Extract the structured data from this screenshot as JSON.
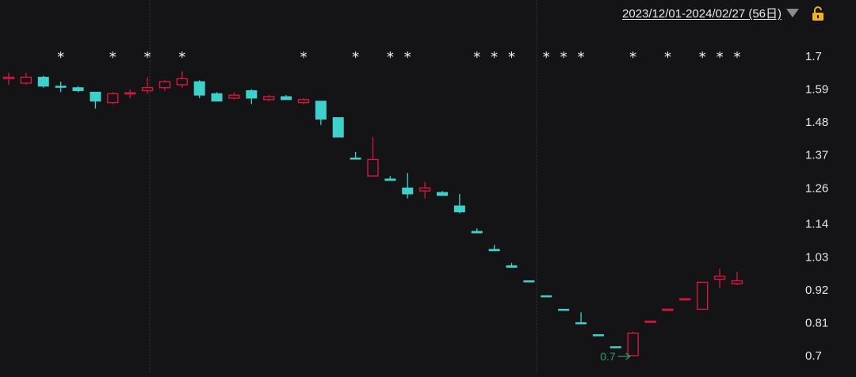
{
  "header": {
    "range_label": "2023/12/01-2024/02/27 (56日)",
    "caret_icon": "triangle-down-icon",
    "lock_icon": "unlocked-padlock-icon"
  },
  "colors": {
    "background": "#141416",
    "up": "#d6173f",
    "down": "#3ed1cc",
    "grid": "#3a3a3e",
    "min_marker": "#2f9e6a"
  },
  "chart_data": {
    "type": "candlestick",
    "title": "",
    "xlabel": "",
    "ylabel": "",
    "ylim": [
      0.67,
      1.73
    ],
    "y_ticks": [
      "1.7",
      "1.59",
      "1.48",
      "1.37",
      "1.26",
      "1.14",
      "1.03",
      "0.92",
      "0.81",
      "0.7"
    ],
    "grid": "vertical dashed separators",
    "candles": [
      {
        "o": 1.625,
        "h": 1.645,
        "l": 1.605,
        "c": 1.63,
        "dir": "up"
      },
      {
        "o": 1.61,
        "h": 1.645,
        "l": 1.605,
        "c": 1.63,
        "dir": "up"
      },
      {
        "o": 1.63,
        "h": 1.635,
        "l": 1.595,
        "c": 1.6,
        "dir": "down"
      },
      {
        "o": 1.6,
        "h": 1.615,
        "l": 1.58,
        "c": 1.6,
        "dir": "down"
      },
      {
        "o": 1.595,
        "h": 1.6,
        "l": 1.58,
        "c": 1.585,
        "dir": "down"
      },
      {
        "o": 1.58,
        "h": 1.58,
        "l": 1.525,
        "c": 1.55,
        "dir": "down"
      },
      {
        "o": 1.545,
        "h": 1.58,
        "l": 1.54,
        "c": 1.575,
        "dir": "up"
      },
      {
        "o": 1.575,
        "h": 1.59,
        "l": 1.56,
        "c": 1.578,
        "dir": "up"
      },
      {
        "o": 1.585,
        "h": 1.63,
        "l": 1.575,
        "c": 1.595,
        "dir": "up"
      },
      {
        "o": 1.595,
        "h": 1.62,
        "l": 1.585,
        "c": 1.615,
        "dir": "up"
      },
      {
        "o": 1.605,
        "h": 1.65,
        "l": 1.595,
        "c": 1.625,
        "dir": "up"
      },
      {
        "o": 1.615,
        "h": 1.62,
        "l": 1.56,
        "c": 1.57,
        "dir": "down"
      },
      {
        "o": 1.575,
        "h": 1.58,
        "l": 1.55,
        "c": 1.55,
        "dir": "down"
      },
      {
        "o": 1.56,
        "h": 1.58,
        "l": 1.555,
        "c": 1.57,
        "dir": "up"
      },
      {
        "o": 1.585,
        "h": 1.59,
        "l": 1.54,
        "c": 1.56,
        "dir": "down"
      },
      {
        "o": 1.555,
        "h": 1.57,
        "l": 1.55,
        "c": 1.565,
        "dir": "up"
      },
      {
        "o": 1.565,
        "h": 1.57,
        "l": 1.555,
        "c": 1.555,
        "dir": "down"
      },
      {
        "o": 1.545,
        "h": 1.56,
        "l": 1.54,
        "c": 1.555,
        "dir": "up"
      },
      {
        "o": 1.55,
        "h": 1.55,
        "l": 1.47,
        "c": 1.49,
        "dir": "down"
      },
      {
        "o": 1.495,
        "h": 1.495,
        "l": 1.43,
        "c": 1.43,
        "dir": "down"
      },
      {
        "o": 1.36,
        "h": 1.38,
        "l": 1.36,
        "c": 1.36,
        "dir": "down"
      },
      {
        "o": 1.3,
        "h": 1.43,
        "l": 1.3,
        "c": 1.355,
        "dir": "up"
      },
      {
        "o": 1.29,
        "h": 1.3,
        "l": 1.285,
        "c": 1.285,
        "dir": "down"
      },
      {
        "o": 1.26,
        "h": 1.31,
        "l": 1.225,
        "c": 1.24,
        "dir": "down"
      },
      {
        "o": 1.25,
        "h": 1.28,
        "l": 1.225,
        "c": 1.26,
        "dir": "up"
      },
      {
        "o": 1.245,
        "h": 1.25,
        "l": 1.235,
        "c": 1.235,
        "dir": "down"
      },
      {
        "o": 1.2,
        "h": 1.24,
        "l": 1.175,
        "c": 1.18,
        "dir": "down"
      },
      {
        "o": 1.115,
        "h": 1.125,
        "l": 1.11,
        "c": 1.11,
        "dir": "down"
      },
      {
        "o": 1.055,
        "h": 1.07,
        "l": 1.05,
        "c": 1.05,
        "dir": "down"
      },
      {
        "o": 1.0,
        "h": 1.01,
        "l": 0.995,
        "c": 0.995,
        "dir": "down"
      },
      {
        "o": 0.95,
        "h": 0.95,
        "l": 0.948,
        "c": 0.948,
        "dir": "down"
      },
      {
        "o": 0.9,
        "h": 0.9,
        "l": 0.898,
        "c": 0.898,
        "dir": "down"
      },
      {
        "o": 0.855,
        "h": 0.855,
        "l": 0.853,
        "c": 0.853,
        "dir": "down"
      },
      {
        "o": 0.81,
        "h": 0.845,
        "l": 0.81,
        "c": 0.81,
        "dir": "down"
      },
      {
        "o": 0.77,
        "h": 0.77,
        "l": 0.768,
        "c": 0.768,
        "dir": "down"
      },
      {
        "o": 0.73,
        "h": 0.73,
        "l": 0.728,
        "c": 0.728,
        "dir": "down"
      },
      {
        "o": 0.7,
        "h": 0.78,
        "l": 0.7,
        "c": 0.775,
        "dir": "up"
      },
      {
        "o": 0.815,
        "h": 0.815,
        "l": 0.813,
        "c": 0.815,
        "dir": "up"
      },
      {
        "o": 0.855,
        "h": 0.855,
        "l": 0.853,
        "c": 0.855,
        "dir": "up"
      },
      {
        "o": 0.89,
        "h": 0.89,
        "l": 0.888,
        "c": 0.89,
        "dir": "up"
      },
      {
        "o": 0.855,
        "h": 0.945,
        "l": 0.855,
        "c": 0.945,
        "dir": "up"
      },
      {
        "o": 0.955,
        "h": 0.99,
        "l": 0.925,
        "c": 0.965,
        "dir": "up"
      },
      {
        "o": 0.94,
        "h": 0.98,
        "l": 0.935,
        "c": 0.95,
        "dir": "up"
      }
    ],
    "star_markers": "*",
    "min_annotation": "0.7"
  }
}
